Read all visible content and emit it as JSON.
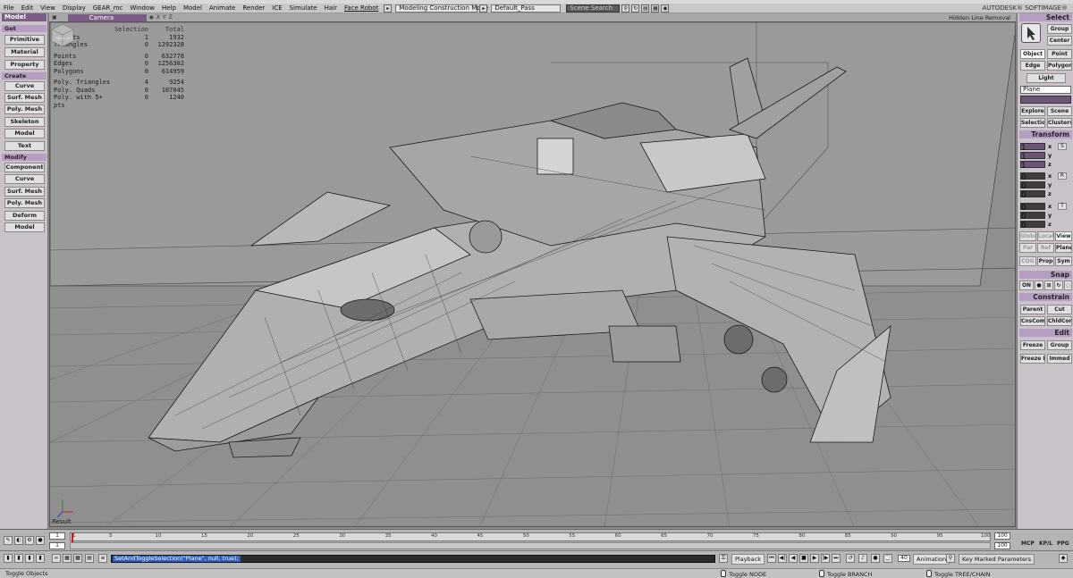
{
  "menubar": {
    "items": [
      "File",
      "Edit",
      "View",
      "Display",
      "GEAR_mc",
      "Window",
      "Help",
      "Model",
      "Animate",
      "Render",
      "ICE",
      "Simulate",
      "Hair",
      "Face Robot"
    ],
    "mode": "Modeling Construction Mode",
    "pass": "Default_Pass",
    "search_placeholder": "Scene Search",
    "brand": "AUTODESK® SOFTIMAGE®"
  },
  "left_panel": {
    "module": "Model",
    "sections": [
      {
        "title": "Get",
        "buttons": [
          "Primitive",
          "Material",
          "Property"
        ]
      },
      {
        "title": "Create",
        "buttons": [
          "Curve",
          "Surf. Mesh",
          "Poly. Mesh",
          "Skeleton",
          "Model",
          "Text"
        ]
      },
      {
        "title": "Modify",
        "buttons": [
          "Component",
          "Curve",
          "Surf. Mesh",
          "Poly. Mesh",
          "Deform",
          "Model"
        ]
      }
    ]
  },
  "viewport": {
    "camera": "Camera",
    "header_icons": [
      "X",
      "Y",
      "Z"
    ],
    "display_mode": "Hidden Line Removal",
    "result_label": "Result",
    "stats_header": {
      "selection": "Selection",
      "total": "Total"
    },
    "stats": [
      {
        "label": "Objects",
        "selection": "1",
        "total": "1932"
      },
      {
        "label": "Triangles",
        "selection": "0",
        "total": "1292328"
      },
      {
        "label": "Points",
        "selection": "0",
        "total": "632778"
      },
      {
        "label": "Edges",
        "selection": "0",
        "total": "1256302"
      },
      {
        "label": "Polygons",
        "selection": "0",
        "total": "614959"
      },
      {
        "label": "Poly. Triangles",
        "selection": "4",
        "total": "9254"
      },
      {
        "label": "Poly. Quads",
        "selection": "0",
        "total": "107045"
      },
      {
        "label": "Poly. with 5+ pts",
        "selection": "0",
        "total": "1240"
      }
    ],
    "view_cube_labels": [
      "BACK",
      "LEFT"
    ]
  },
  "right_panel": {
    "select": {
      "title": "Select",
      "buttons": [
        "Group",
        "Center",
        "Object",
        "Point",
        "Edge",
        "Polygon",
        "Light"
      ],
      "name_value": "Plane",
      "explore": "Explore",
      "scene": "Scene",
      "selection": "Selection",
      "clusters": "Clusters"
    },
    "transform": {
      "title": "Transform",
      "scale": [
        "1",
        "1",
        "1"
      ],
      "rotate": [
        "0",
        "0",
        "0"
      ],
      "translate": [
        "0",
        "0",
        "0"
      ],
      "axes": [
        "x",
        "y",
        "z"
      ],
      "icons": [
        "S",
        "R",
        "T"
      ],
      "modes_row1": [
        "Global",
        "Local",
        "View"
      ],
      "modes_row2": [
        "Par",
        "Ref",
        "Plane"
      ],
      "modes_row3": [
        "COG",
        "Prop",
        "Sym"
      ]
    },
    "snap": {
      "title": "Snap",
      "on": "ON"
    },
    "constrain": {
      "title": "Constrain",
      "buttons": [
        "Parent",
        "Cut",
        "CnsComp",
        "ChldComp"
      ]
    },
    "edit": {
      "title": "Edit",
      "buttons": [
        "Freeze",
        "Group",
        "Freeze M",
        "Immed"
      ]
    }
  },
  "timeline": {
    "start": "1",
    "end": "100",
    "current": "1",
    "end_field": "100",
    "ticks": [
      "1",
      "5",
      "10",
      "15",
      "20",
      "25",
      "30",
      "35",
      "40",
      "45",
      "50",
      "55",
      "60",
      "65",
      "70",
      "75",
      "80",
      "85",
      "90",
      "95",
      "100"
    ],
    "tabs": [
      "MCP",
      "KP/L",
      "PPG"
    ],
    "range_end": "100"
  },
  "command": {
    "text": "SetAndToggleSelection(\"Plane\", null, true);",
    "playback": "Playback",
    "animation": "Animation",
    "auto": "Auto",
    "key_marked": "Key Marked Parameters",
    "frame_value": "40"
  },
  "status": {
    "left": "Toggle Objects",
    "mouse1": "Toggle NODE",
    "mouse2": "Toggle BRANCH",
    "mouse3": "Toggle TREE/CHAIN"
  }
}
